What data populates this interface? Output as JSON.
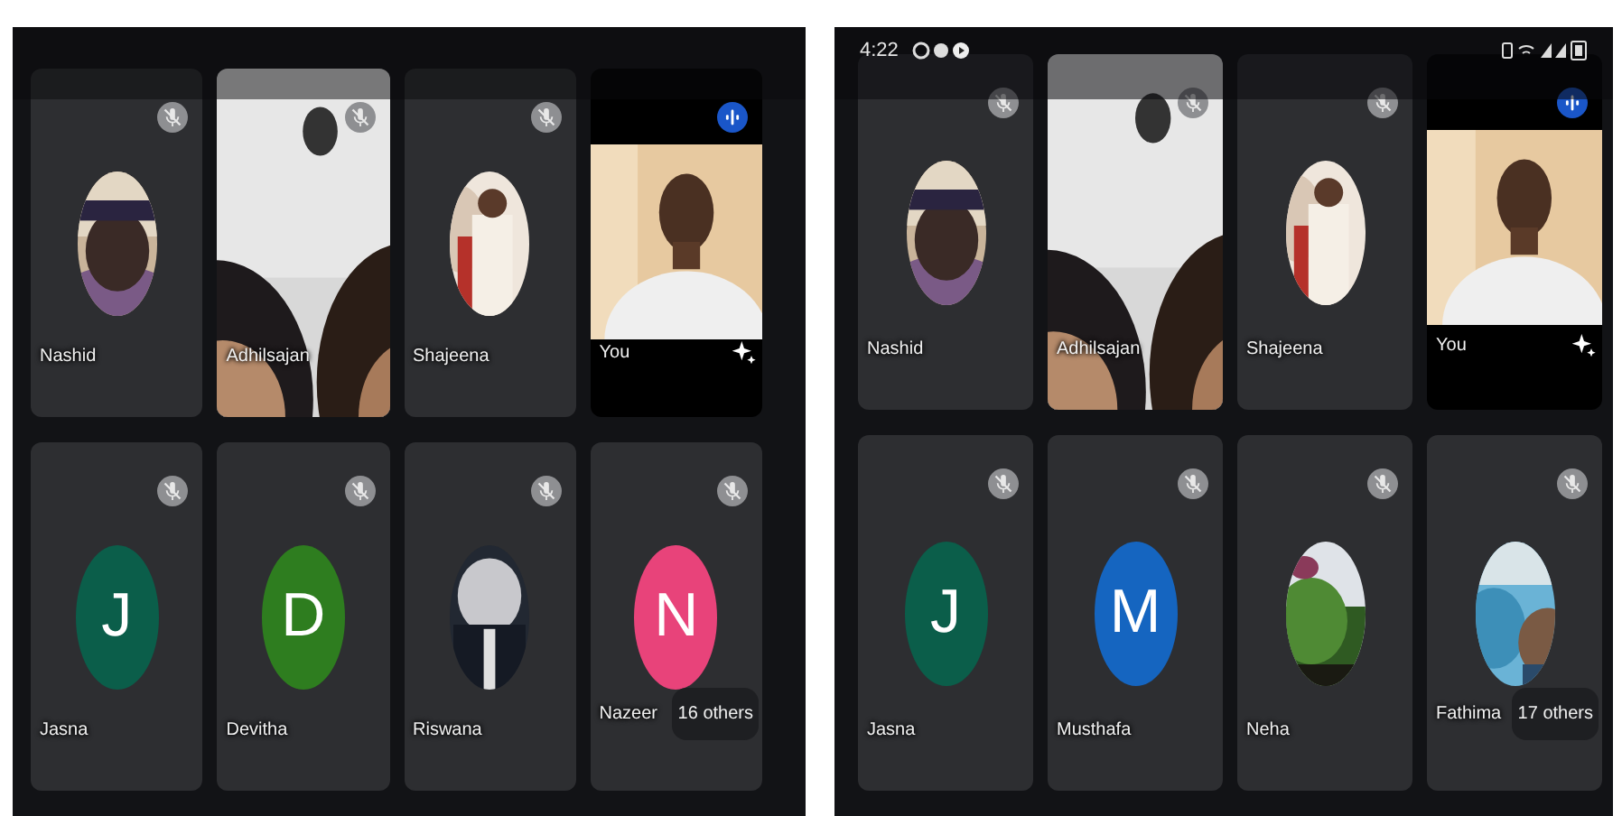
{
  "screens": [
    {
      "others": "16 others",
      "tiles": [
        {
          "name": "Nashid",
          "muted": true
        },
        {
          "name": "Adhilsajan",
          "kind": "video",
          "muted": true
        },
        {
          "name": "Shajeena",
          "muted": true
        },
        {
          "name": "You",
          "kind": "self",
          "muted": false
        },
        {
          "name": "Jasna",
          "kind": "initial",
          "initial": "J",
          "color": "#0b5e4a",
          "muted": true
        },
        {
          "name": "Devitha",
          "kind": "initial",
          "initial": "D",
          "color": "#2e7d1f",
          "muted": true
        },
        {
          "name": "Riswana",
          "muted": true
        },
        {
          "name": "Nazeer",
          "kind": "initial",
          "initial": "N",
          "color": "#e8437a",
          "muted": true
        }
      ]
    },
    {
      "status_bar": {
        "time": "4:22"
      },
      "others": "17 others",
      "tiles": [
        {
          "name": "Nashid",
          "muted": true
        },
        {
          "name": "Adhilsajan",
          "kind": "video",
          "muted": true
        },
        {
          "name": "Shajeena",
          "muted": true
        },
        {
          "name": "You",
          "kind": "self",
          "muted": false
        },
        {
          "name": "Jasna",
          "kind": "initial",
          "initial": "J",
          "color": "#0b5e4a",
          "muted": true
        },
        {
          "name": "Musthafa",
          "kind": "initial",
          "initial": "M",
          "color": "#1565c0",
          "muted": true
        },
        {
          "name": "Neha",
          "muted": true
        },
        {
          "name": "Fathima",
          "muted": true
        }
      ]
    }
  ]
}
